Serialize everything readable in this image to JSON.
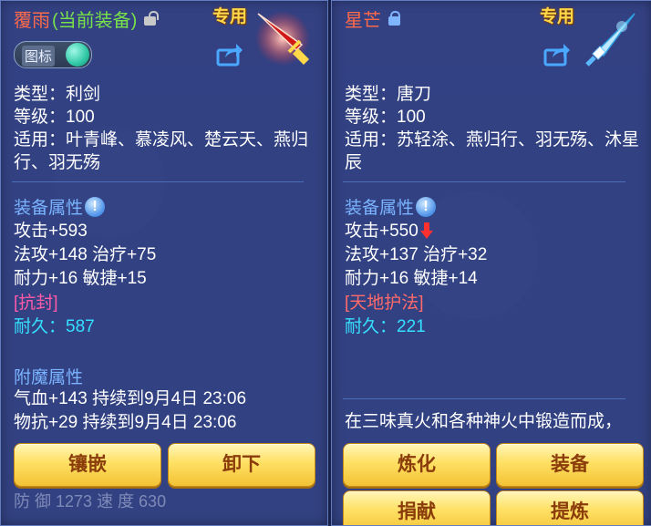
{
  "left_item": {
    "name": "覆雨",
    "equipped_tag": "(当前装备)",
    "exclusive_badge": "专用",
    "icon_toggle_label": "图标",
    "type": "类型：利剑",
    "level": "等级：100",
    "applicable": "适用：叶青峰、慕凌风、楚云天、燕归行、羽无殇",
    "attr_header": "装备属性",
    "attack": "攻击+593",
    "magic_heal": "法攻+148 治疗+75",
    "stamina_agility": "耐力+16 敏捷+15",
    "special_tag": "[抗封]",
    "durability": "耐久：587",
    "enchant_header": "附魔属性",
    "enchant_1": "气血+143 持续到9月4日 23:06",
    "enchant_2": "物抗+29 持续到9月4日 23:06",
    "buttons": {
      "inlay": "镶嵌",
      "unequip": "卸下"
    },
    "bg_stats": "防 御    1273        速 度    630"
  },
  "right_item": {
    "name": "星芒",
    "exclusive_badge": "专用",
    "type": "类型：唐刀",
    "level": "等级：100",
    "applicable": "适用：苏轻涂、燕归行、羽无殇、沐星辰",
    "attr_header": "装备属性",
    "attack": "攻击+550",
    "magic_heal": "法攻+137 治疗+32",
    "stamina_agility": "耐力+16 敏捷+14",
    "special_tag": "[天地护法]",
    "durability": "耐久：221",
    "description": "在三味真火和各种神火中锻造而成，",
    "buttons": {
      "refine": "炼化",
      "equip": "装备",
      "donate": "捐献",
      "extract": "提炼"
    }
  },
  "colors": {
    "name_red": "#ff6a4a",
    "equipped_green": "#78e14a",
    "attr_blue": "#7ab3ff",
    "durability_cyan": "#35e0ff",
    "tag_pink": "#ff5aa8",
    "button_yellow": "#ffe063"
  },
  "icons": [
    "lock-open-icon",
    "lock-closed-icon",
    "share-icon",
    "info-icon",
    "sword-icon",
    "blade-icon",
    "arrow-down-icon",
    "toggle-knob"
  ]
}
